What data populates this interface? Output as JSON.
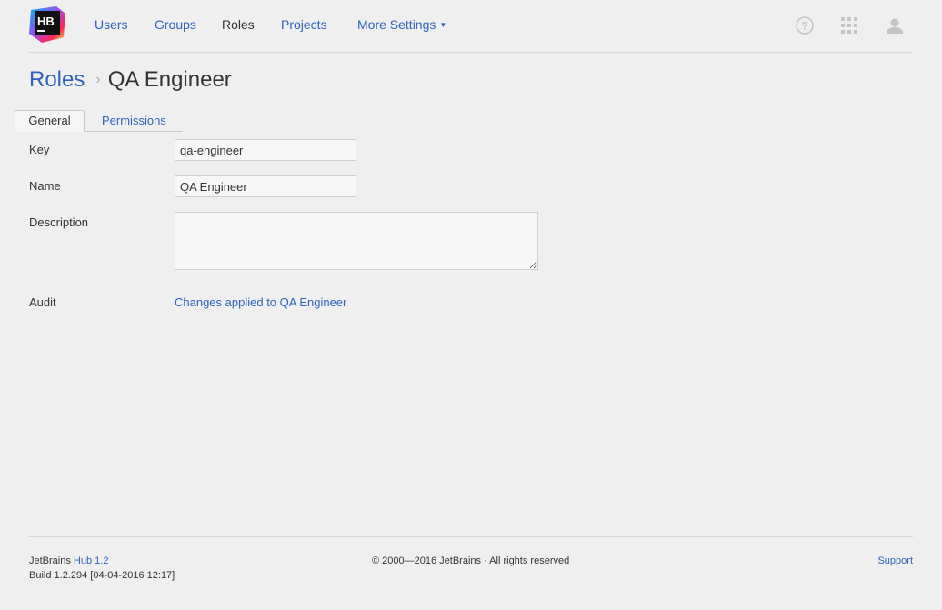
{
  "header": {
    "logo_text": "HB",
    "nav": {
      "users": "Users",
      "groups": "Groups",
      "roles": "Roles",
      "projects": "Projects",
      "more_settings": "More Settings"
    },
    "icons": [
      "help-icon",
      "apps-grid-icon",
      "user-avatar-icon"
    ]
  },
  "breadcrumb": {
    "parent": "Roles",
    "separator": "›",
    "current": "QA Engineer"
  },
  "tabs": {
    "general": "General",
    "permissions": "Permissions"
  },
  "form": {
    "key_label": "Key",
    "key_value": "qa-engineer",
    "name_label": "Name",
    "name_value": "QA Engineer",
    "description_label": "Description",
    "description_value": "",
    "audit_label": "Audit",
    "audit_link": "Changes applied to QA Engineer"
  },
  "footer": {
    "brand": "JetBrains",
    "product_link": "Hub 1.2",
    "build": "Build 1.2.294 [04-04-2016 12:17]",
    "copyright": "© 2000—2016 JetBrains · All rights reserved",
    "support": "Support"
  },
  "colors": {
    "link": "#2f63b9",
    "background": "#efefef"
  }
}
